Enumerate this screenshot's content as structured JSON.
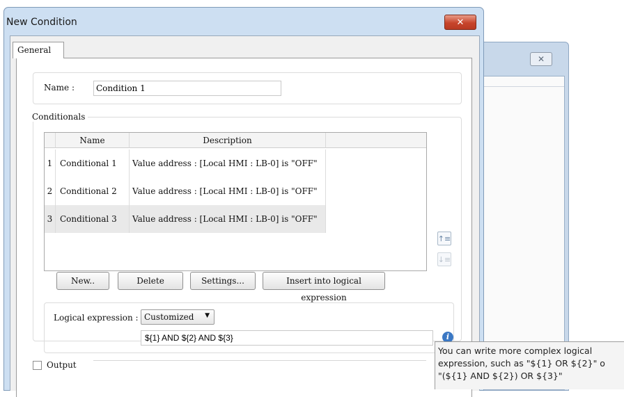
{
  "background_window": {
    "close_glyph": "✕"
  },
  "dialog": {
    "title": "New Condition",
    "close_glyph": "✕",
    "tabs": [
      {
        "label": "General"
      }
    ]
  },
  "name_field": {
    "label": "Name :",
    "value": "Condition 1"
  },
  "conditionals": {
    "legend": "Conditionals",
    "columns": [
      "Name",
      "Description"
    ],
    "rows": [
      {
        "index": "1",
        "name": "Conditional 1",
        "description": "Value address : [Local HMI : LB-0] is \"OFF\""
      },
      {
        "index": "2",
        "name": "Conditional 2",
        "description": "Value address : [Local HMI : LB-0] is \"OFF\""
      },
      {
        "index": "3",
        "name": "Conditional 3",
        "description": "Value address : [Local HMI : LB-0] is \"OFF\""
      }
    ],
    "move_up_icon": "move-up-icon",
    "move_down_icon": "move-down-icon"
  },
  "buttons": {
    "new": "New..",
    "delete": "Delete",
    "settings": "Settings...",
    "insert": "Insert into logical expression"
  },
  "logical_expression": {
    "label": "Logical expression :",
    "mode": "Customized",
    "expression": "${1} AND ${2} AND ${3}",
    "info_glyph": "i"
  },
  "output": {
    "label": "Output",
    "checked": false
  },
  "tooltip": {
    "line1": "You can write more complex logical",
    "line2": "expression, such as \"${1} OR ${2}\" o",
    "line3": "\"(${1} AND ${2}) OR ${3}\""
  },
  "colors": {
    "title_bar": "#cddff2",
    "close_button": "#c7452c",
    "info_icon": "#3b78c4",
    "selected_row": "#e9e9e9"
  }
}
